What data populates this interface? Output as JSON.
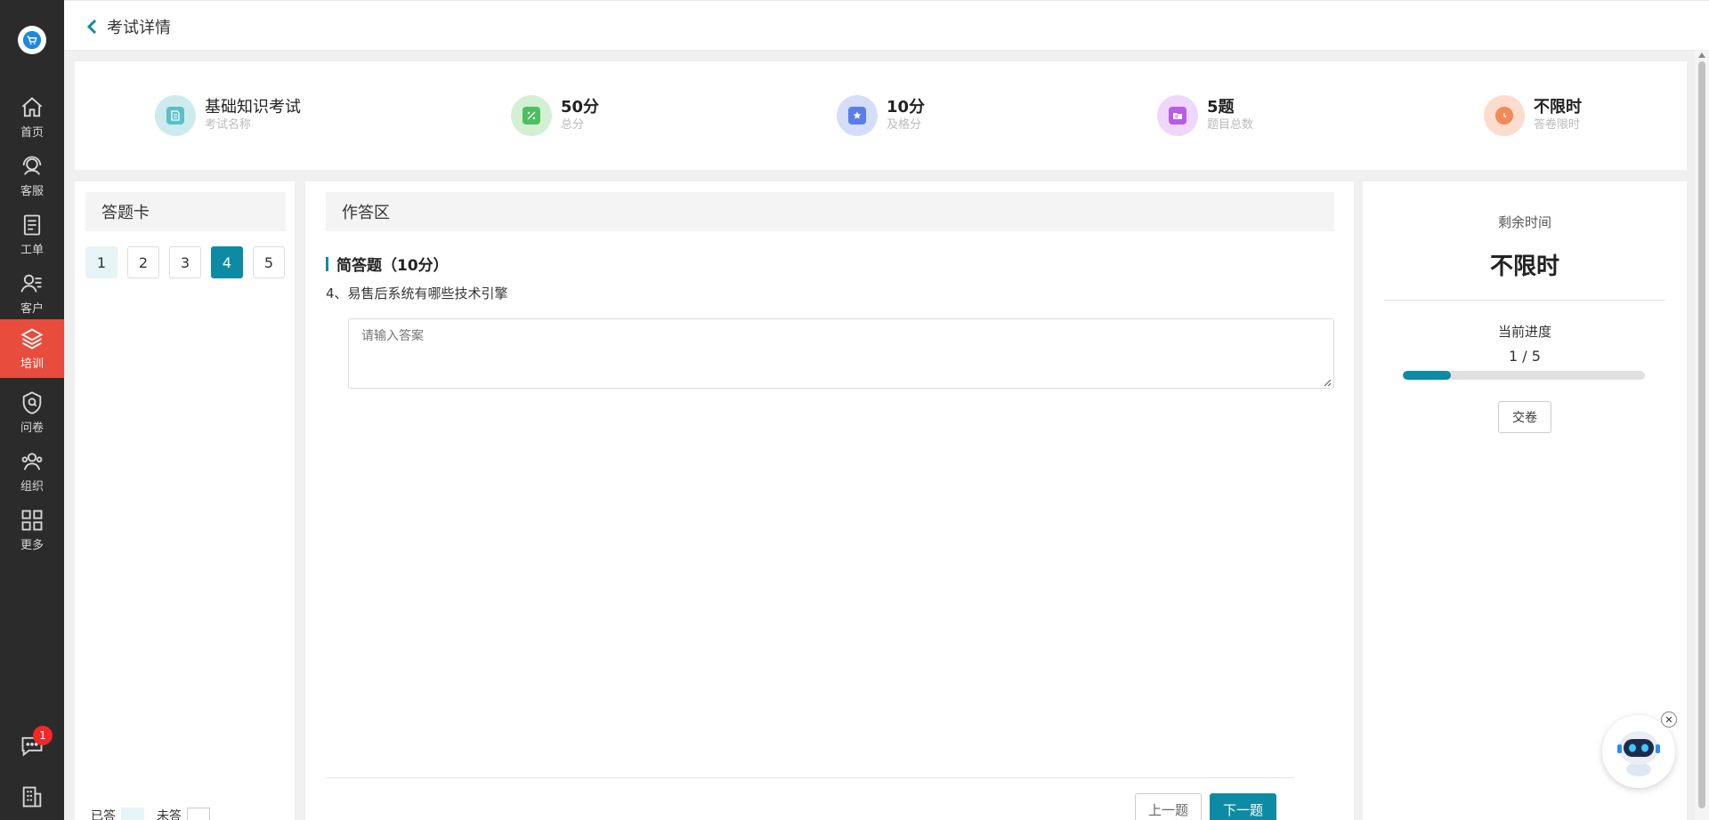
{
  "header": {
    "back_title": "考试详情"
  },
  "sidebar": {
    "items": [
      {
        "label": "首页",
        "icon": "home-icon"
      },
      {
        "label": "客服",
        "icon": "headset-icon"
      },
      {
        "label": "工单",
        "icon": "clipboard-icon"
      },
      {
        "label": "客户",
        "icon": "customer-icon"
      },
      {
        "label": "培训",
        "icon": "layers-icon",
        "active": true
      },
      {
        "label": "问卷",
        "icon": "survey-shield-icon"
      },
      {
        "label": "组织",
        "icon": "team-icon"
      },
      {
        "label": "更多",
        "icon": "grid-icon"
      }
    ],
    "chat_badge": "1"
  },
  "exam_info": [
    {
      "value": "基础知识考试",
      "label": "考试名称",
      "icon": "document-icon",
      "color": "#5bbfc7"
    },
    {
      "value": "50分",
      "label": "总分",
      "icon": "percent-icon",
      "color": "#4cc05e"
    },
    {
      "value": "10分",
      "label": "及格分",
      "icon": "star-icon",
      "color": "#5b7fe8"
    },
    {
      "value": "5题",
      "label": "题目总数",
      "icon": "folder-icon",
      "color": "#b85be6"
    },
    {
      "value": "不限时",
      "label": "答卷限时",
      "icon": "clock-icon",
      "color": "#f28a5a"
    }
  ],
  "answer_card": {
    "title": "答题卡",
    "questions": [
      "1",
      "2",
      "3",
      "4",
      "5"
    ],
    "current": "4",
    "answered": [
      "1"
    ],
    "legend_answered": "已答",
    "legend_unanswered": "未答"
  },
  "answer_area": {
    "title": "作答区",
    "question_type": "简答题（10分）",
    "question_text": "4、易售后系统有哪些技术引擎",
    "answer_placeholder": "请输入答案",
    "prev_label": "上一题",
    "next_label": "下一题"
  },
  "status_panel": {
    "time_label": "剩余时间",
    "time_value": "不限时",
    "progress_label": "当前进度",
    "progress_text": "1 / 5",
    "progress_fraction": 0.2,
    "submit_label": "交卷"
  },
  "colors": {
    "accent": "#0e8ba4",
    "sidebar_bg": "#2b2b2b",
    "active_nav": "#e74c3c"
  }
}
